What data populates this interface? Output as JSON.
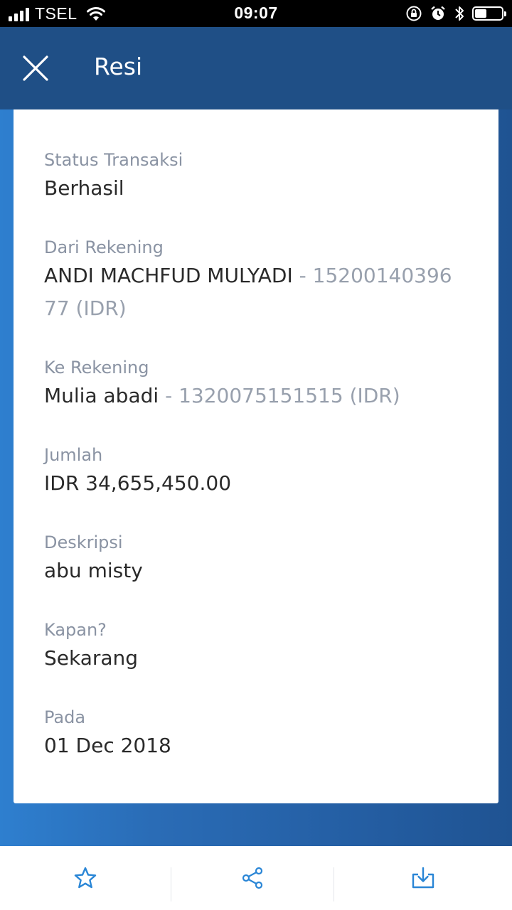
{
  "status_bar": {
    "carrier": "TSEL",
    "time": "09:07",
    "battery_level": 0.45
  },
  "app_bar": {
    "title": "Resi"
  },
  "receipt": {
    "status": {
      "label": "Status Transaksi",
      "value": "Berhasil"
    },
    "from": {
      "label": "Dari Rekening",
      "name": "ANDI MACHFUD MULYADI",
      "account_line1": " - 15200140396",
      "account_line2": "77 (IDR)"
    },
    "to": {
      "label": "Ke Rekening",
      "name": "Mulia abadi",
      "account": " - 1320075151515 (IDR)"
    },
    "amount": {
      "label": "Jumlah",
      "value": "IDR 34,655,450.00"
    },
    "description": {
      "label": "Deskripsi",
      "value": "abu misty"
    },
    "when": {
      "label": "Kapan?",
      "value": "Sekarang"
    },
    "date": {
      "label": "Pada",
      "value": "01 Dec 2018"
    }
  },
  "colors": {
    "app_bar": "#1f4f86",
    "accent_icon": "#2a86d6",
    "label": "#8a93a3",
    "value": "#2a2a2a"
  }
}
